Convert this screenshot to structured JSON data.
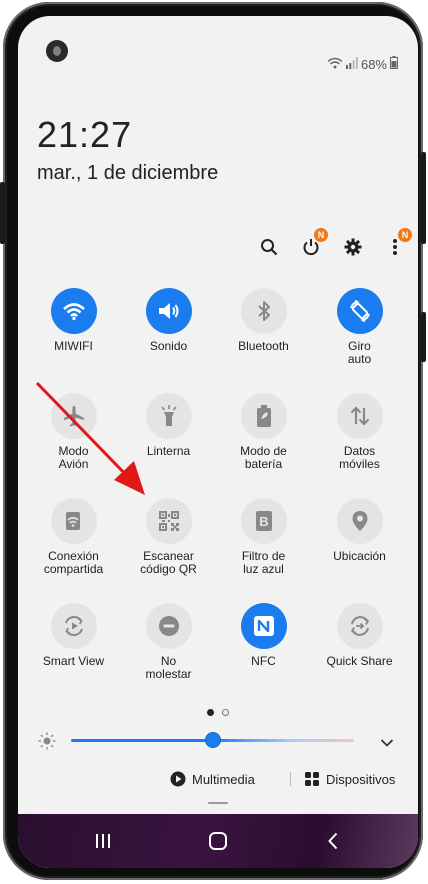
{
  "status_bar": {
    "battery": "68%"
  },
  "clock": {
    "time": "21:27",
    "date": "mar., 1 de diciembre"
  },
  "toolbar": {
    "power_badge": "N",
    "more_badge": "N"
  },
  "tiles": [
    {
      "label": "MIWIFI",
      "active": true,
      "icon": "wifi-icon"
    },
    {
      "label": "Sonido",
      "active": true,
      "icon": "speaker-icon"
    },
    {
      "label": "Bluetooth",
      "active": false,
      "icon": "bluetooth-icon"
    },
    {
      "label": "Giro\nauto",
      "active": true,
      "icon": "auto-rotate-icon"
    },
    {
      "label": "Modo\nAvión",
      "active": false,
      "icon": "airplane-icon"
    },
    {
      "label": "Linterna",
      "active": false,
      "icon": "flashlight-icon"
    },
    {
      "label": "Modo de\nbatería",
      "active": false,
      "icon": "battery-mode-icon"
    },
    {
      "label": "Datos\nmóviles",
      "active": false,
      "icon": "mobile-data-icon"
    },
    {
      "label": "Conexión\ncompartida",
      "active": false,
      "icon": "hotspot-icon"
    },
    {
      "label": "Escanear\ncódigo QR",
      "active": false,
      "icon": "qr-code-icon"
    },
    {
      "label": "Filtro de\nluz azul",
      "active": false,
      "icon": "blue-light-filter-icon"
    },
    {
      "label": "Ubicación",
      "active": false,
      "icon": "location-pin-icon"
    },
    {
      "label": "Smart View",
      "active": false,
      "icon": "smart-view-icon"
    },
    {
      "label": "No\nmolestar",
      "active": false,
      "icon": "do-not-disturb-icon"
    },
    {
      "label": "NFC",
      "active": true,
      "icon": "nfc-icon"
    },
    {
      "label": "Quick Share",
      "active": false,
      "icon": "quick-share-icon"
    }
  ],
  "pager": {
    "pages": 2,
    "current": 1
  },
  "brightness": {
    "level": 0.5
  },
  "media": {
    "multimedia_label": "Multimedia",
    "devices_label": "Dispositivos"
  },
  "colors": {
    "accent": "#1b7cf0",
    "badge": "#f07a1a",
    "arrow": "#e01818"
  }
}
